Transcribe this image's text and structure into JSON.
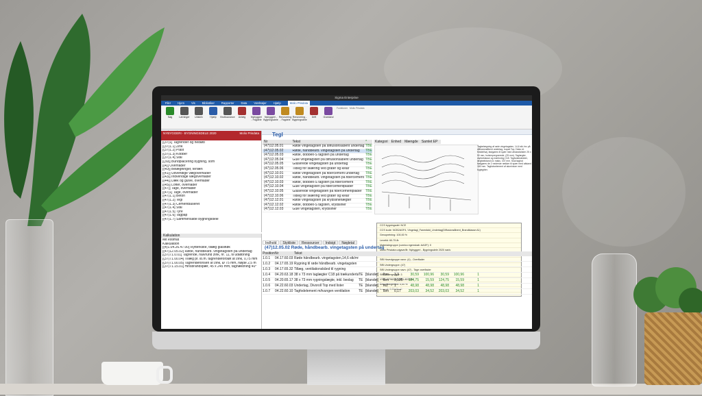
{
  "window": {
    "title": "Sigma Enterprise"
  },
  "menu": [
    "Filer",
    "Hjem",
    "Vis",
    "Bibliotiker",
    "Rapporter",
    "Data",
    "Værktøjer",
    "Hjælp",
    "Molio Prisdata"
  ],
  "menu_active": "Molio Prisdata",
  "ribbon": {
    "buttons": [
      {
        "label": "Søg",
        "color": "#2a8a2a"
      },
      {
        "label": "Læninger",
        "color": "#555555"
      },
      {
        "label": "Udskriv",
        "color": "#555555"
      },
      {
        "label": "Hjælp",
        "color": "#2a5ca8"
      },
      {
        "label": "Bruttoavance",
        "color": "#555555"
      },
      {
        "label": "Anlæg",
        "color": "#a33030"
      },
      {
        "label": "Nybyggeri - Fagdele",
        "color": "#7a4aa0"
      },
      {
        "label": "Nybyggeri - Bygningsdele",
        "color": "#7a4aa0"
      },
      {
        "label": "Renovering - Fagdele",
        "color": "#c08a20"
      },
      {
        "label": "Renovering - Bygningsdele",
        "color": "#c08a20"
      },
      {
        "label": "Drift",
        "color": "#a33030"
      },
      {
        "label": "Grønland",
        "color": "#7a4aa0"
      }
    ],
    "group1": "Funktioner",
    "group2": "Molio Prisdata"
  },
  "docbar": "Nybyggeri - Bygningsdele 2020",
  "banner": {
    "title": "NYBYGGERI - BYGNINGSDELE 2020",
    "logo": "Molio Prisdata"
  },
  "tree": [
    "[(37)1] Tagrender og nedløb",
    "[(37)1.1] Zink",
    "[(37)1.2] Plast",
    "[(37)1.3] Kobber",
    "[(37)1.4] Stål",
    "[(39)] Bundplacering bygning, som",
    "[(4)] Overflader",
    "[(40)] Belægninger, terræn",
    "[(41)] Udvendige vægoverflader",
    "[(43)] Indvendige vægoverflader",
    "[(44)] Dæk og gulve, overflader",
    "[(45)] Lofter, overflader",
    "[(47)] Tage, overflader",
    "[(47)1] Tage, overflader",
    "[(47)1.1] Beton",
    "[(47)1.2] Tegl",
    "[(47)1.3] Cementbaseret",
    "[(47)1.4] Stål",
    "[(47)1.5] Tyre",
    "[(47)1.6] Tagpap",
    "[(47)1.7] Sammensatte bygningsdele"
  ],
  "section_title": "Tegl",
  "grid": {
    "headers": [
      "Nr",
      "Tekst",
      "*"
    ],
    "rows": [
      {
        "nr": "(47)12.05.01",
        "text": "Røde vingetagsten på diffusionsåbent undertag",
        "flag": "TBE"
      },
      {
        "nr": "(47)12.05.02",
        "text": "Røde, håndbearb. vingetagsten på undertag",
        "flag": "TBE"
      },
      {
        "nr": "(47)12.05.03",
        "text": "Røde, dobbelt-S tagsten på undertag",
        "flag": "TBE"
      },
      {
        "nr": "(47)12.05.04",
        "text": "Gule vingetagsten på diffusionsåbent undertag",
        "flag": "TBE"
      },
      {
        "nr": "(47)12.05.05",
        "text": "Glaserede vingetagsten på undertag",
        "flag": "TBE"
      },
      {
        "nr": "(47)12.05.06",
        "text": "Tilbeg for skæring ved grater og kelar",
        "flag": "TBE"
      },
      {
        "nr": "(47)12.10.01",
        "text": "Røde vingetagsten på fibercement undertag",
        "flag": "TBE"
      },
      {
        "nr": "(47)12.10.02",
        "text": "Røde, håndbearb. vingetagsten på fibercement",
        "flag": "TBE"
      },
      {
        "nr": "(47)12.10.03",
        "text": "Røde, dobbelt-S tagsten på fibercement",
        "flag": "TBE"
      },
      {
        "nr": "(47)12.10.04",
        "text": "Gule vingetagsten på fibercementplader",
        "flag": "TBE"
      },
      {
        "nr": "(47)12.10.05",
        "text": "Glaserede vingetagsten på fibercementplader",
        "flag": "TBE"
      },
      {
        "nr": "(47)12.10.06",
        "text": "Tilbeg for skæring ved grater og kelar",
        "flag": "TBE"
      },
      {
        "nr": "(47)12.12.01",
        "text": "Røde vingetagsten på krydslinerlægter",
        "flag": "TBE"
      },
      {
        "nr": "(47)12.12.02",
        "text": "Røde, dobbelt-S tagsten, krydsliner",
        "flag": "TBE"
      },
      {
        "nr": "(47)12.12.03",
        "text": "Gule vingetagsten, krydsliner",
        "flag": "TBE"
      }
    ]
  },
  "col_headers": [
    "Kategori",
    "Enhed",
    "Mængde",
    "Samlet EP"
  ],
  "description": "Tagbelægning af røde vingetagsten, 14,6 stk./m² på diffusionsåbent undertag, Icopal Top, Dako et. Middelhøj, fastgøres til spær med afstandslister 25 x 50 mm, hulsimpregnerede, (25 mm). Taglægter, styrkeklasse og mærkning C18. Tagfodsbrædder, lægteafstand c/c maks. 337 mm. Skal tagfod fastgøres de 2 nederste rækker til spær med afstand 180 mm. Tagfodselement af aluminium med fuglegitter.",
  "tooltip": [
    "CCS bygningsdel: NCE",
    "CCS kode: NCB2AGF4, Vingetagl_Fanesfald_Undertag(Diffusionsåbent_Brandklasse:A1)",
    "Genopretning: 100,00 %",
    "Levetid: 60-75 år",
    "Materialegruppe (curnico egenskab: AAGF): 0",
    "Molio Prisdata udgave/år: Nybyggeri - Bygningsdele 2020 nødv",
    "SfB Hovedgruppe: (4)",
    "SfB Hovedgruppe navn: (4) - Overflader",
    "SfB Undergruppe: (47)",
    "SfB Undergruppe navn: (47) - Tage overflader",
    "SfB Undergruppe: 3",
    "VSID: 37982-8G4501-803884",
    "Årlig vedligehold: 0,00 %",
    "λ-værdi: 0,30 W/mK"
  ],
  "lower_left": {
    "header": "Kalkulation",
    "items": [
      "Mit estimat",
      "Kalkulation",
      "[(4)1.04.26.47.00] Rytterkiste, tillæg glaslfløk",
      "[(47)12.05.02] Røde, håndbearb. vingetagsten på undertag",
      "[(37)71.0.01] Tagrende, halvrund zink, nr. 11, til udløbning",
      "[(37)71.00.04] Tillæg pr. lb.m. tagrendeforbløt af zink, 0,75 mm",
      "[(37)71.00.05] Tagrendeforlsen af zink, Ø 75 mm, højde 2,5 m",
      "[(37)71.15.01] Hinsbrändspær, 45 x 245 mm, taghældning 40°"
    ]
  },
  "lower_tabs": [
    "Indhold",
    "Stykliste",
    "Ressourcer",
    "Indsigt",
    "Nøgletal"
  ],
  "lower_title": "(47)12.05.02 Røde, håndbearb. vingetagsten på undertag",
  "lower_table": {
    "headers": [
      "Position",
      "Nr",
      "Tekst",
      "",
      "",
      "",
      "",
      "",
      "",
      "",
      "",
      ""
    ],
    "rows": [
      {
        "pos": "1.0.1",
        "nr": "04.17.60.03",
        "text": "Røde håndbearb. vingetagsten,14,6 stk/m²",
        "q": "",
        "k": "",
        "u": "",
        "n": "",
        "a": "",
        "b": "",
        "c": "",
        "d": "",
        "e": ""
      },
      {
        "pos": "1.0.2",
        "nr": "04.17.65.19",
        "text": "Rygning til røde håndbearb. vingetagsten",
        "q": "",
        "k": "",
        "u": "",
        "n": "",
        "a": "",
        "b": "",
        "c": "",
        "d": "",
        "e": ""
      },
      {
        "pos": "1.0.3",
        "nr": "04.17.65.32",
        "text": "Tillæg, ventilationsbånd til rygning",
        "q": "",
        "k": "",
        "u": "",
        "n": "",
        "a": "",
        "b": "",
        "c": "",
        "d": "",
        "e": ""
      },
      {
        "pos": "1.0.4",
        "nr": "04.20.63.18",
        "text": "38 x 73 mm taglægter C18 på trækundertag",
        "q": "TE",
        "k": "[blandet]",
        "u": "lbm",
        "n": "3,3",
        "a": "30,59",
        "b": "100,96",
        "c": "30,59",
        "d": "100,96",
        "e": "1"
      },
      {
        "pos": "1.0.5",
        "nr": "04.20.65.17",
        "text": "38 x 73 mm rygningslægte, inkl. beslag",
        "q": "TE",
        "k": "[blandet]",
        "u": "lbm",
        "n": "0,125",
        "a": "124,75",
        "b": "15,59",
        "c": "124,75",
        "d": "15,59",
        "e": "1"
      },
      {
        "pos": "1.0.6",
        "nr": "04.22.60.03",
        "text": "Undertag, Divoroll Top med lister",
        "q": "TE",
        "k": "[blandet]",
        "u": "m2",
        "n": "1",
        "a": "48,98",
        "b": "48,98",
        "c": "48,98",
        "d": "48,98",
        "e": "1"
      },
      {
        "pos": "1.0.7",
        "nr": "04.22.60.10",
        "text": "Tagfodelement m/tvungen ventilation",
        "q": "TE",
        "k": "[blandet]",
        "u": "lbm",
        "n": "0,17",
        "a": "203,03",
        "b": "34,52",
        "c": "203,03",
        "d": "34,52",
        "e": "1"
      }
    ]
  }
}
